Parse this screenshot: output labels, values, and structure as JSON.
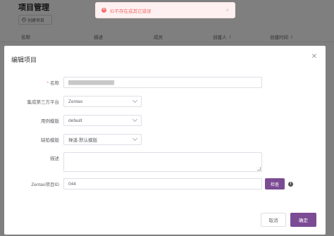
{
  "background": {
    "title": "项目管理",
    "create_button": "创建项目",
    "columns": [
      "名称",
      "描述",
      "成员",
      "创建人",
      "创建时间"
    ]
  },
  "toast": {
    "message": "ID不存在或其它错误",
    "type": "error",
    "color": "#f56c6c"
  },
  "modal": {
    "title": "编辑项目",
    "fields": {
      "name": {
        "label": "名称",
        "required": true,
        "value": "▇▇▇▇▇▇▇▇▇▇▇▇▇"
      },
      "platform": {
        "label": "集成第三方平台",
        "value": "Zentao"
      },
      "case_template": {
        "label": "用例模版",
        "value": "default"
      },
      "issue_template": {
        "label": "缺陷模版",
        "value": "禅道-默认模版"
      },
      "description": {
        "label": "描述",
        "value": ""
      },
      "zentao_id": {
        "label": "Zentao项目ID",
        "value": "044",
        "check_button": "检查"
      }
    },
    "cancel_label": "取消",
    "ok_label": "确定",
    "accent_color": "#7b4b94"
  }
}
